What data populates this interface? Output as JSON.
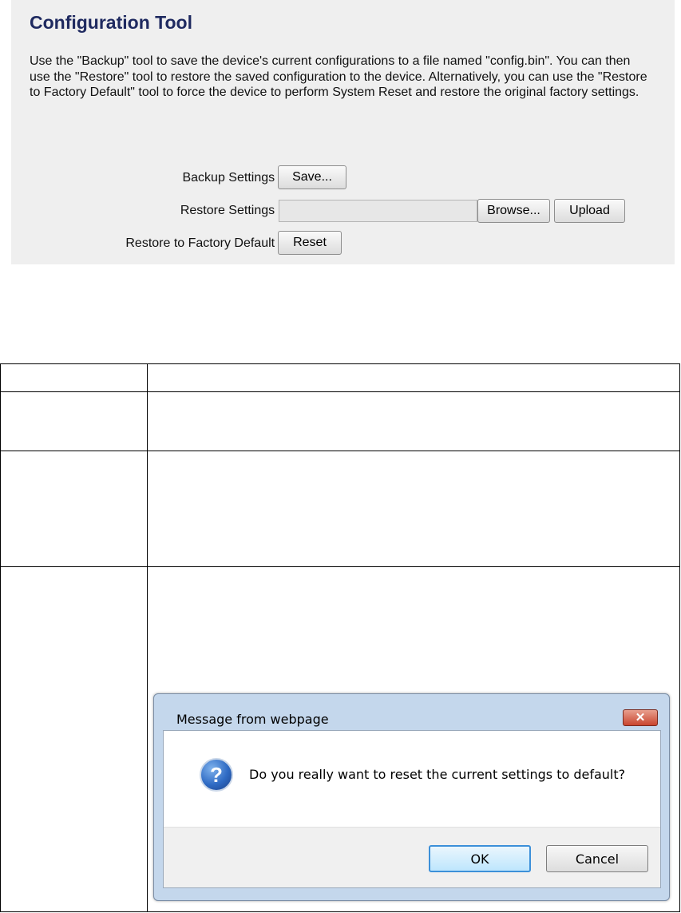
{
  "panel": {
    "title": "Configuration Tool",
    "description": "Use the \"Backup\" tool to save the device's current configurations to a file named \"config.bin\". You can then use the \"Restore\" tool to restore the saved configuration to the device. Alternatively, you can use the \"Restore to Factory Default\" tool to force the device to perform System Reset and restore the original factory settings.",
    "backup_label": "Backup Settings :",
    "save_button": "Save...",
    "restore_label": "Restore Settings :",
    "file_value": "",
    "browse_button": "Browse...",
    "upload_button": "Upload",
    "factory_label": "Restore to Factory Default :",
    "reset_button": "Reset"
  },
  "dialog": {
    "title": "Message from webpage",
    "close_symbol": "✕",
    "icon_glyph": "?",
    "message": "Do you really want to reset the current settings to default?",
    "ok_button": "OK",
    "cancel_button": "Cancel"
  },
  "icons": {
    "dialog_icon": "question-icon",
    "close_icon": "close-icon"
  },
  "colors": {
    "panel_bg": "#efefef",
    "title_color": "#1f2a60",
    "dialog_frame": "#c4d7ec",
    "close_button": "#c9452f"
  }
}
